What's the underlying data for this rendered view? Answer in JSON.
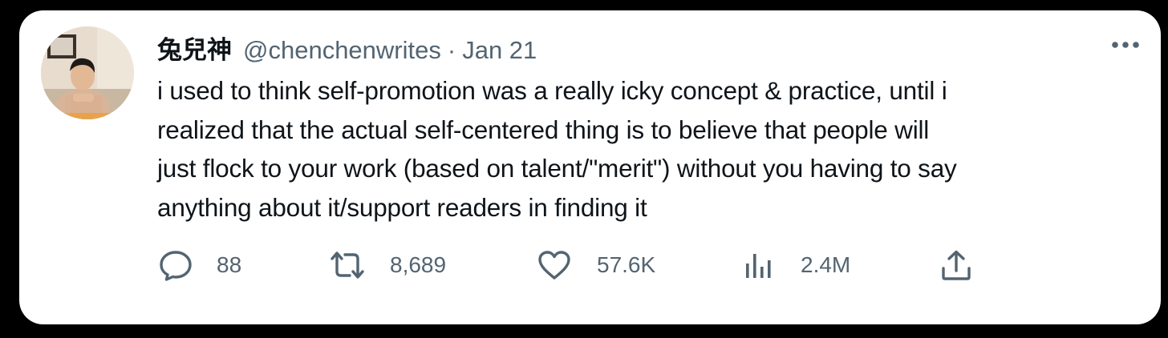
{
  "tweet": {
    "display_name": "兔兒神",
    "handle": "@chenchenwrites",
    "separator": "·",
    "date": "Jan 21",
    "text_lines": [
      "i used to think self-promotion was a really icky concept & practice, until i",
      "realized that the actual self-centered thing is to believe that people will",
      "just flock to your work (based on talent/\"merit\") without you having to say",
      "anything about it/support readers in finding it"
    ]
  },
  "actions": {
    "replies": "88",
    "retweets": "8,689",
    "likes": "57.6K",
    "views": "2.4M"
  },
  "icons": {
    "more": "more-horizontal-icon",
    "reply": "reply-icon",
    "retweet": "retweet-icon",
    "like": "heart-icon",
    "views": "views-icon",
    "share": "share-icon"
  },
  "colors": {
    "page_background": "#000000",
    "card_background": "#ffffff",
    "text_primary": "#0f1419",
    "text_secondary": "#536471"
  }
}
